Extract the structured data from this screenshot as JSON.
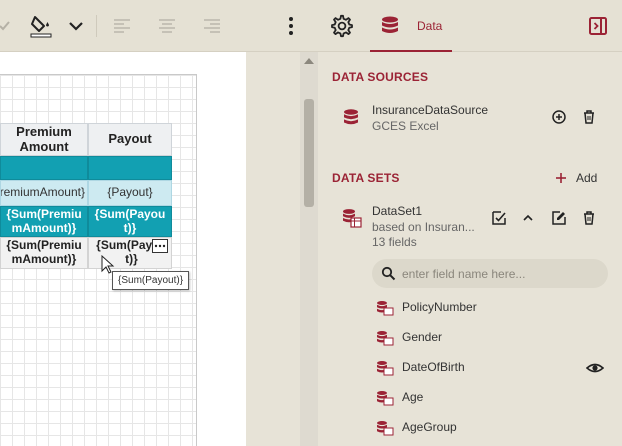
{
  "toolbar": {
    "tools": [
      "check-icon",
      "fill-color-icon",
      "chevron-down-icon",
      "align-left-icon",
      "align-center-icon",
      "align-right-icon",
      "more-vertical-icon",
      "gear-icon"
    ],
    "data_tab": "Data",
    "preview_icon": "panel-toggle-icon"
  },
  "designer": {
    "table": {
      "headers": [
        "Premium Amount",
        "Payout"
      ],
      "detail": [
        "{PremiumAmount}",
        "{Payout}"
      ],
      "sum_row_1": [
        "{Sum(PremiumAmount)}",
        "{Sum(Payout)}"
      ],
      "sum_row_2": [
        "{Sum(PremiumAmount)}",
        "{Sum(Payout)}"
      ]
    },
    "tooltip": "{Sum(Payout)}"
  },
  "panel": {
    "data_sources_title": "DATA SOURCES",
    "data_source": {
      "name": "InsuranceDataSource",
      "type": "GCES Excel"
    },
    "data_sets_title": "DATA SETS",
    "add_label": "Add",
    "data_set": {
      "name": "DataSet1",
      "based_on": "based on Insuran...",
      "fields_count": "13 fields"
    },
    "search_placeholder": "enter field name here...",
    "fields": [
      "PolicyNumber",
      "Gender",
      "DateOfBirth",
      "Age",
      "AgeGroup"
    ]
  },
  "colors": {
    "accent": "#9b2335",
    "teal": "#12a0b2",
    "panel_bg": "#e7e3d7"
  }
}
